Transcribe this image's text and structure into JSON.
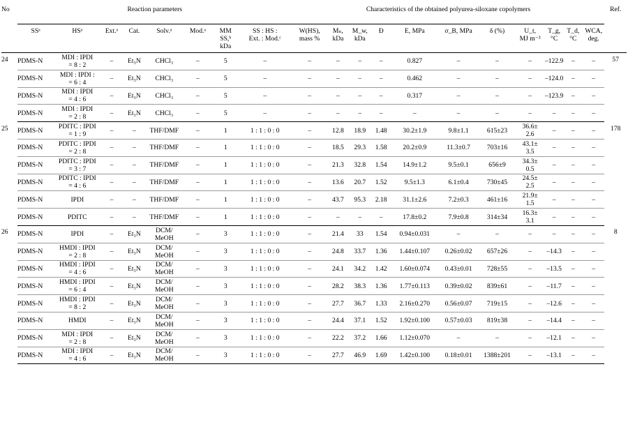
{
  "header": {
    "group_reaction": "Reaction parameters",
    "group_characteristics": "Characteristics of the obtained polyurea-siloxane copolymers",
    "col_no": "No",
    "col_ref": "Ref.",
    "columns": [
      "SSᵃ",
      "HSᵃ",
      "Ext.ᵃ",
      "Cat.",
      "Solv.ᵃ",
      "Mod.ᵃ",
      "MM\nSS,ᵇ\nkDa",
      "SS : HS :\nExt. : Mod.ᶜ",
      "W(HS),\nmass %",
      "Mₙ,\nkDa",
      "M_w,\nkDa",
      "Đ",
      "E, MPa",
      "σ_B, MPa",
      "δ (%)",
      "U_t,\nMJ m⁻³",
      "T_g,\n°C",
      "T_d,\n°C",
      "WCA,\ndeg."
    ]
  },
  "groups": [
    {
      "no": "24",
      "ref": "57",
      "rows": [
        [
          "PDMS-N",
          "MDI : IPDI\n= 8 : 2",
          "–",
          "Et₃N",
          "CHCl₃",
          "–",
          "5",
          "–",
          "–",
          "–",
          "–",
          "–",
          "0.827",
          "–",
          "–",
          "–",
          "–122.9",
          "–",
          "–"
        ],
        [
          "PDMS-N",
          "MDI : IPDI :\n= 6 : 4",
          "–",
          "Et₃N",
          "CHCl₃",
          "–",
          "5",
          "–",
          "–",
          "–",
          "–",
          "–",
          "0.462",
          "–",
          "–",
          "–",
          "–124.0",
          "–",
          "–"
        ],
        [
          "PDMS-N",
          "MDI : IPDI\n= 4 : 6",
          "–",
          "Et₃N",
          "CHCl₃",
          "–",
          "5",
          "–",
          "–",
          "–",
          "–",
          "–",
          "0.317",
          "–",
          "–",
          "–",
          "–123.9",
          "–",
          "–"
        ],
        [
          "PDMS-N",
          "MDI : IPDI\n= 2 : 8",
          "–",
          "Et₃N",
          "CHCl₃",
          "–",
          "5",
          "–",
          "–",
          "–",
          "–",
          "–",
          "–",
          "–",
          "–",
          "–",
          "–",
          "–",
          "–"
        ]
      ]
    },
    {
      "no": "25",
      "ref": "178",
      "rows": [
        [
          "PDMS-N",
          "PDITC : IPDI\n= 1 : 9",
          "–",
          "–",
          "THF/DMF",
          "–",
          "1",
          "1 : 1 : 0 : 0",
          "–",
          "12.8",
          "18.9",
          "1.48",
          "30.2±1.9",
          "9.8±1.1",
          "615±23",
          "36.6±\n2.6",
          "–",
          "–",
          "–"
        ],
        [
          "PDMS-N",
          "PDITC : IPDI\n= 2 : 8",
          "–",
          "–",
          "THF/DMF",
          "–",
          "1",
          "1 : 1 : 0 : 0",
          "–",
          "18.5",
          "29.3",
          "1.58",
          "20.2±0.9",
          "11.3±0.7",
          "703±16",
          "43.1±\n3.5",
          "–",
          "–",
          "–"
        ],
        [
          "PDMS-N",
          "PDITC : IPDI\n= 3 : 7",
          "–",
          "–",
          "THF/DMF",
          "–",
          "1",
          "1 : 1 : 0 : 0",
          "–",
          "21.3",
          "32.8",
          "1.54",
          "14.9±1.2",
          "9.5±0.1",
          "656±9",
          "34.3±\n0.5",
          "–",
          "–",
          "–"
        ],
        [
          "PDMS-N",
          "PDITC : IPDI\n= 4 : 6",
          "–",
          "–",
          "THF/DMF",
          "–",
          "1",
          "1 : 1 : 0 : 0",
          "–",
          "13.6",
          "20.7",
          "1.52",
          "9.5±1.3",
          "6.1±0.4",
          "730±45",
          "24.5±\n2.5",
          "–",
          "–",
          "–"
        ],
        [
          "PDMS-N",
          "IPDI",
          "–",
          "–",
          "THF/DMF",
          "–",
          "1",
          "1 : 1 : 0 : 0",
          "–",
          "43.7",
          "95.3",
          "2.18",
          "31.1±2.6",
          "7.2±0.3",
          "461±16",
          "21.9±\n1.5",
          "–",
          "–",
          "–"
        ],
        [
          "PDMS-N",
          "PDITC",
          "–",
          "–",
          "THF/DMF",
          "–",
          "1",
          "1 : 1 : 0 : 0",
          "–",
          "–",
          "–",
          "–",
          "17.8±0.2",
          "7.9±0.8",
          "314±34",
          "16.3±\n3.1",
          "–",
          "–",
          "–"
        ]
      ]
    },
    {
      "no": "26",
      "ref": "8",
      "rows": [
        [
          "PDMS-N",
          "IPDI",
          "–",
          "Et₃N",
          "DCM/\nMeOH",
          "–",
          "3",
          "1 : 1 : 0 : 0",
          "–",
          "21.4",
          "33",
          "1.54",
          "0.94±0.031",
          "–",
          "–",
          "–",
          "–",
          "–",
          "–"
        ],
        [
          "PDMS-N",
          "HMDI : IPDI\n= 2 : 8",
          "–",
          "Et₃N",
          "DCM/\nMeOH",
          "–",
          "3",
          "1 : 1 : 0 : 0",
          "–",
          "24.8",
          "33.7",
          "1.36",
          "1.44±0.107",
          "0.26±0.02",
          "657±26",
          "–",
          "–14.3",
          "–",
          "–"
        ],
        [
          "PDMS-N",
          "HMDI : IPDI\n= 4 : 6",
          "–",
          "Et₃N",
          "DCM/\nMeOH",
          "–",
          "3",
          "1 : 1 : 0 : 0",
          "–",
          "24.1",
          "34.2",
          "1.42",
          "1.60±0.074",
          "0.43±0.01",
          "728±55",
          "–",
          "–13.5",
          "–",
          "–"
        ],
        [
          "PDMS-N",
          "HMDI : IPDI\n= 6 : 4",
          "–",
          "Et₃N",
          "DCM/\nMeOH",
          "–",
          "3",
          "1 : 1 : 0 : 0",
          "–",
          "28.2",
          "38.3",
          "1.36",
          "1.77±0.113",
          "0.39±0.02",
          "839±61",
          "–",
          "–11.7",
          "–",
          "–"
        ],
        [
          "PDMS-N",
          "HMDI : IPDI\n= 8 : 2",
          "–",
          "Et₃N",
          "DCM/\nMeOH",
          "–",
          "3",
          "1 : 1 : 0 : 0",
          "–",
          "27.7",
          "36.7",
          "1.33",
          "2.16±0.270",
          "0.56±0.07",
          "719±15",
          "–",
          "–12.6",
          "–",
          "–"
        ],
        [
          "PDMS-N",
          "HMDI",
          "–",
          "Et₃N",
          "DCM/\nMeOH",
          "–",
          "3",
          "1 : 1 : 0 : 0",
          "–",
          "24.4",
          "37.1",
          "1.52",
          "1.92±0.100",
          "0.57±0.03",
          "819±38",
          "–",
          "–14.4",
          "–",
          "–"
        ],
        [
          "PDMS-N",
          "MDI : IPDI\n= 2 : 8",
          "–",
          "Et₃N",
          "DCM/\nMeOH",
          "–",
          "3",
          "1 : 1 : 0 : 0",
          "–",
          "22.2",
          "37.2",
          "1.66",
          "1.12±0.070",
          "–",
          "–",
          "–",
          "–12.1",
          "–",
          "–"
        ],
        [
          "PDMS-N",
          "MDI : IPDI\n= 4 : 6",
          "–",
          "Et₃N",
          "DCM/\nMeOH",
          "–",
          "3",
          "1 : 1 : 0 : 0",
          "–",
          "27.7",
          "46.9",
          "1.69",
          "1.42±0.100",
          "0.18±0.01",
          "1388±201",
          "–",
          "–13.1",
          "–",
          "–"
        ]
      ]
    }
  ]
}
